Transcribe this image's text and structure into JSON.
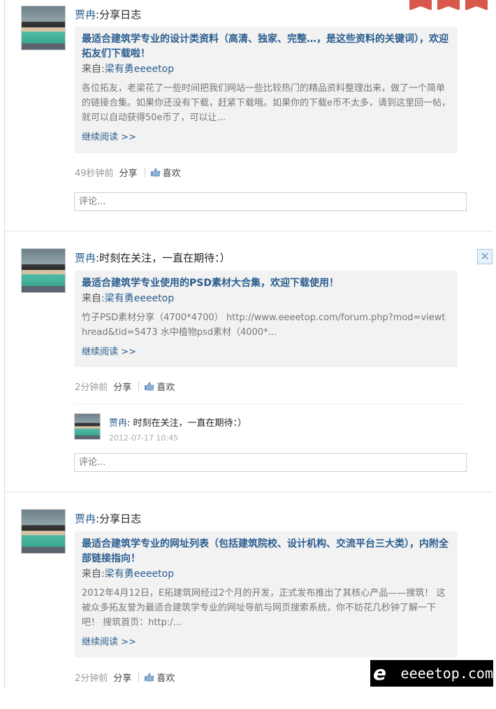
{
  "posts": [
    {
      "author": "贾冉",
      "action": ":分享日志",
      "title": "最适合建筑学专业的设计类资料（高清、独家、完整…，是这些资料的关键词），欢迎拓友们下载啦！",
      "from_prefix": "来自:",
      "from_user": "梁有勇eeeetop",
      "excerpt": "各位拓友，老梁花了一些时间把我们网站一些比较热门的精品资料整理出来，做了一个简单的链接合集。如果你还没有下载，赶紧下载哦。如果你的下载e币不太多，请到这里回一帖，就可以自动获得50e币了，可以让...",
      "read_more": "继续阅读 >>",
      "time": "49秒钟前",
      "share": "分享",
      "like": "喜欢",
      "comment_placeholder": "评论..."
    },
    {
      "author": "贾冉",
      "action": ":时刻在关注，一直在期待：）",
      "title": "最适合建筑学专业使用的PSD素材大合集，欢迎下载使用！",
      "from_prefix": "来自:",
      "from_user": "梁有勇eeeetop",
      "excerpt": "竹子PSD素材分享（4700*4700） http://www.eeeetop.com/forum.php?mod=viewthread&tid=5473 水中植物psd素材（4000*...",
      "read_more": "继续阅读 >>",
      "time": "2分钟前",
      "share": "分享",
      "like": "喜欢",
      "reply": {
        "author": "贾冉",
        "text": ": 时刻在关注，一直在期待：）",
        "time": "2012-07-17 10:45"
      },
      "comment_placeholder": "评论..."
    },
    {
      "author": "贾冉",
      "action": ":分享日志",
      "title": "最适合建筑学专业的网址列表（包括建筑院校、设计机构、交流平台三大类），内附全部链接指向！",
      "from_prefix": "来自:",
      "from_user": "梁有勇eeeetop",
      "excerpt": "2012年4月12日，E拓建筑网经过2个月的开发，正式发布推出了其核心产品——搜筑！ 这被众多拓友誉为最适合建筑学专业的网址导航与网页搜索系统，你不妨花几秒钟了解一下吧！ 搜筑首页：http:/...",
      "read_more": "继续阅读 >>",
      "time": "2分钟前",
      "share": "分享",
      "like": "喜欢"
    }
  ],
  "close_glyph": "✕",
  "watermark": {
    "logo_text": "e拓",
    "site": "eeeetop.com"
  },
  "colors": {
    "link": "#2a5d8f",
    "card_bg": "#f2f2f2",
    "ribbon": "#d9574b"
  }
}
